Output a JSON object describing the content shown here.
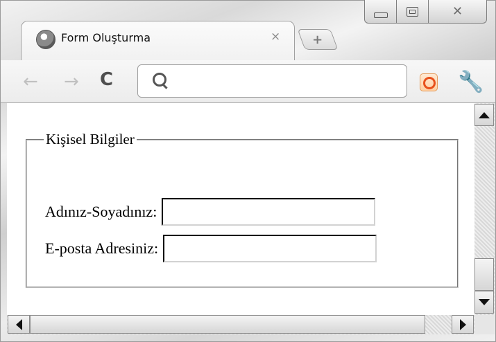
{
  "window": {
    "controls": [
      "minimize",
      "maximize",
      "close"
    ]
  },
  "tab": {
    "title": "Form Oluşturma",
    "close_glyph": "×",
    "icon": "globe-icon"
  },
  "new_tab": {
    "glyph": "+"
  },
  "toolbar": {
    "back_glyph": "←",
    "forward_glyph": "→",
    "reload_glyph": "C",
    "wrench_glyph": "🔧",
    "omnibox_value": "",
    "extension_icon": "orange-ring-icon"
  },
  "form": {
    "legend": "Kişisel Bilgiler",
    "fields": [
      {
        "label": "Adınız-Soyadınız:",
        "value": ""
      },
      {
        "label": "E-posta Adresiniz:",
        "value": ""
      }
    ]
  },
  "colors": {
    "extension_accent": "#e8501b"
  }
}
